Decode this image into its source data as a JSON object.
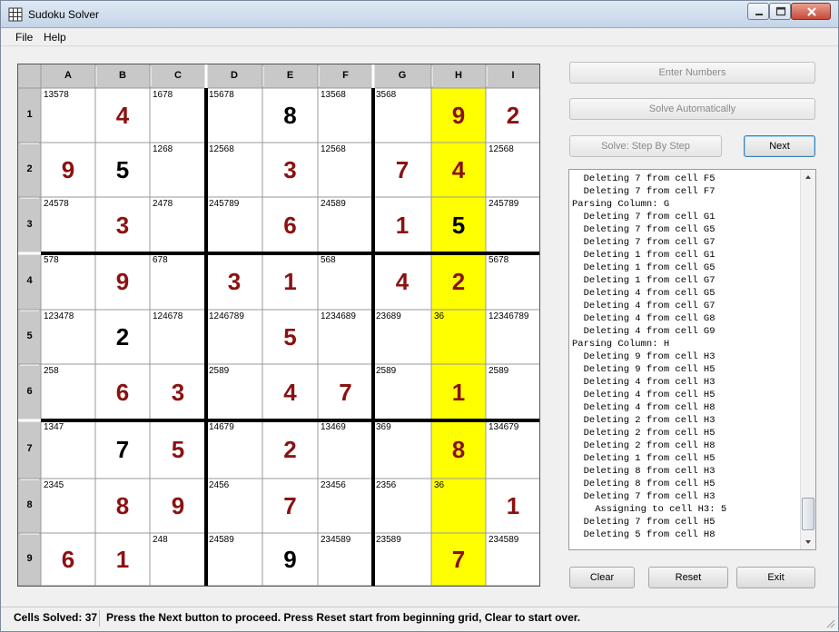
{
  "window": {
    "title": "Sudoku Solver"
  },
  "menu": {
    "file": "File",
    "help": "Help"
  },
  "icons": {
    "app": "grid-icon",
    "minimize": "minimize-icon",
    "maximize": "maximize-icon",
    "close": "close-icon",
    "scroll_up": "chevron-up-icon",
    "scroll_down": "chevron-down-icon",
    "grip": "resize-grip-icon"
  },
  "colors": {
    "highlight_column": "#ffff00",
    "solved_given": "#000000",
    "solved_computed": "#8b1111",
    "header_bg": "#c8c8c8"
  },
  "grid": {
    "col_labels": [
      "A",
      "B",
      "C",
      "D",
      "E",
      "F",
      "G",
      "H",
      "I"
    ],
    "row_labels": [
      "1",
      "2",
      "3",
      "4",
      "5",
      "6",
      "7",
      "8",
      "9"
    ],
    "highlight_col": 7,
    "cells": [
      [
        {
          "c": "13578"
        },
        {
          "v": "4",
          "k": "s"
        },
        {
          "c": "1678"
        },
        {
          "c": "15678"
        },
        {
          "v": "8",
          "k": "g"
        },
        {
          "c": "13568"
        },
        {
          "c": "3568"
        },
        {
          "v": "9",
          "k": "s"
        },
        {
          "v": "2",
          "k": "s"
        }
      ],
      [
        {
          "v": "9",
          "k": "s"
        },
        {
          "v": "5",
          "k": "g"
        },
        {
          "c": "1268"
        },
        {
          "c": "12568"
        },
        {
          "v": "3",
          "k": "s"
        },
        {
          "c": "12568"
        },
        {
          "v": "7",
          "k": "s"
        },
        {
          "v": "4",
          "k": "s"
        },
        {
          "c": "12568"
        }
      ],
      [
        {
          "c": "24578"
        },
        {
          "v": "3",
          "k": "s"
        },
        {
          "c": "2478"
        },
        {
          "c": "245789"
        },
        {
          "v": "6",
          "k": "s"
        },
        {
          "c": "24589"
        },
        {
          "v": "1",
          "k": "s"
        },
        {
          "v": "5",
          "k": "g"
        },
        {
          "c": "245789"
        }
      ],
      [
        {
          "c": "578"
        },
        {
          "v": "9",
          "k": "s"
        },
        {
          "c": "678"
        },
        {
          "v": "3",
          "k": "s"
        },
        {
          "v": "1",
          "k": "s"
        },
        {
          "c": "568"
        },
        {
          "v": "4",
          "k": "s"
        },
        {
          "v": "2",
          "k": "s"
        },
        {
          "c": "5678"
        }
      ],
      [
        {
          "c": "123478"
        },
        {
          "v": "2",
          "k": "g"
        },
        {
          "c": "124678"
        },
        {
          "c": "1246789"
        },
        {
          "v": "5",
          "k": "s"
        },
        {
          "c": "1234689"
        },
        {
          "c": "23689"
        },
        {
          "c": "36"
        },
        {
          "c": "12346789"
        }
      ],
      [
        {
          "c": "258"
        },
        {
          "v": "6",
          "k": "s"
        },
        {
          "v": "3",
          "k": "s"
        },
        {
          "c": "2589"
        },
        {
          "v": "4",
          "k": "s"
        },
        {
          "v": "7",
          "k": "s"
        },
        {
          "c": "2589"
        },
        {
          "v": "1",
          "k": "s"
        },
        {
          "c": "2589"
        }
      ],
      [
        {
          "c": "1347"
        },
        {
          "v": "7",
          "k": "g"
        },
        {
          "v": "5",
          "k": "s"
        },
        {
          "c": "14679"
        },
        {
          "v": "2",
          "k": "s"
        },
        {
          "c": "13469"
        },
        {
          "c": "369"
        },
        {
          "v": "8",
          "k": "s"
        },
        {
          "c": "134679"
        }
      ],
      [
        {
          "c": "2345"
        },
        {
          "v": "8",
          "k": "s"
        },
        {
          "v": "9",
          "k": "s"
        },
        {
          "c": "2456"
        },
        {
          "v": "7",
          "k": "s"
        },
        {
          "c": "23456"
        },
        {
          "c": "2356"
        },
        {
          "c": "36"
        },
        {
          "v": "1",
          "k": "s"
        }
      ],
      [
        {
          "v": "6",
          "k": "s"
        },
        {
          "v": "1",
          "k": "s"
        },
        {
          "c": "248"
        },
        {
          "c": "24589"
        },
        {
          "v": "9",
          "k": "g"
        },
        {
          "c": "234589"
        },
        {
          "c": "23589"
        },
        {
          "v": "7",
          "k": "s"
        },
        {
          "c": "234589"
        }
      ]
    ]
  },
  "buttons": {
    "enter_numbers": "Enter Numbers",
    "solve_auto": "Solve Automatically",
    "solve_step": "Solve:  Step By Step",
    "next": "Next",
    "clear": "Clear",
    "reset": "Reset",
    "exit": "Exit"
  },
  "log": [
    "  Deleting 7 from cell F5",
    "  Deleting 7 from cell F7",
    "Parsing Column: G",
    "  Deleting 7 from cell G1",
    "  Deleting 7 from cell G5",
    "  Deleting 7 from cell G7",
    "  Deleting 1 from cell G1",
    "  Deleting 1 from cell G5",
    "  Deleting 1 from cell G7",
    "  Deleting 4 from cell G5",
    "  Deleting 4 from cell G7",
    "  Deleting 4 from cell G8",
    "  Deleting 4 from cell G9",
    "Parsing Column: H",
    "  Deleting 9 from cell H3",
    "  Deleting 9 from cell H5",
    "  Deleting 4 from cell H3",
    "  Deleting 4 from cell H5",
    "  Deleting 4 from cell H8",
    "  Deleting 2 from cell H3",
    "  Deleting 2 from cell H5",
    "  Deleting 2 from cell H8",
    "  Deleting 1 from cell H5",
    "  Deleting 8 from cell H3",
    "  Deleting 8 from cell H5",
    "  Deleting 7 from cell H3",
    "    Assigning to cell H3: 5",
    "  Deleting 7 from cell H5",
    "  Deleting 5 from cell H8"
  ],
  "status": {
    "cells_solved": "Cells Solved:  37",
    "message": "Press the Next button to proceed.  Press Reset start from beginning grid, Clear to start over."
  }
}
